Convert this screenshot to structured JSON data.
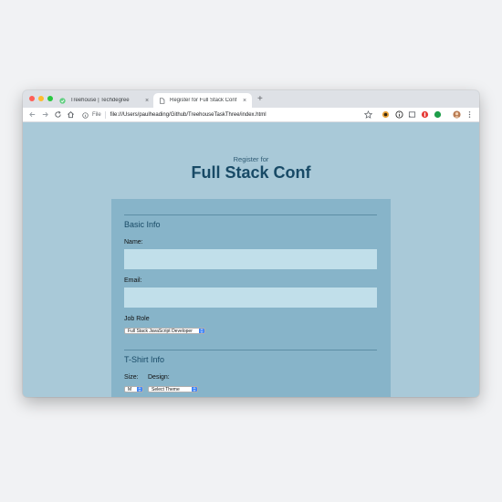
{
  "browser": {
    "tabs": [
      {
        "title": "Treehouse | Techdegree",
        "active": false
      },
      {
        "title": "Register for Full Stack Conf",
        "active": true
      }
    ],
    "new_tab_label": "+",
    "close_label": "×",
    "address_bar": {
      "scheme_label": "File",
      "url": "file:///Users/paulheading/Github/TreehouseTaskThree/index.html"
    }
  },
  "page": {
    "subtitle": "Register for",
    "title": "Full Stack Conf",
    "basic_info": {
      "legend": "Basic Info",
      "name_label": "Name:",
      "name_value": "",
      "email_label": "Email:",
      "email_value": "",
      "job_role_label": "Job Role",
      "job_role_selected": "Full Stack JavaScript Developer"
    },
    "tshirt_info": {
      "legend": "T-Shirt Info",
      "size_label": "Size:",
      "size_selected": "M",
      "design_label": "Design:",
      "design_selected": "Select Theme"
    }
  },
  "colors": {
    "page_bg": "#a9c9d8",
    "form_bg": "#87b4c9",
    "input_bg": "#c1dfea",
    "heading": "#184a66",
    "select_accent": "#3b82f6"
  }
}
